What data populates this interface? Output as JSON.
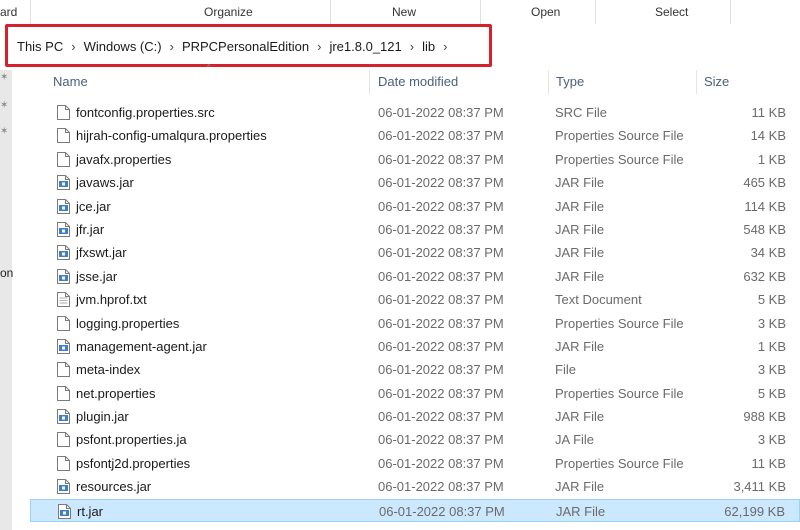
{
  "ribbon": {
    "left_label": "ard",
    "organize": "Organize",
    "new": "New",
    "open": "Open",
    "select": "Select"
  },
  "address_bar": {
    "crumbs": [
      "This PC",
      "Windows (C:)",
      "PRPCPersonalEdition",
      "jre1.8.0_121",
      "lib"
    ]
  },
  "side": {
    "text": "on"
  },
  "columns": {
    "name": "Name",
    "date": "Date modified",
    "type": "Type",
    "size": "Size"
  },
  "files": [
    {
      "name": "fontconfig.properties.src",
      "date": "06-01-2022 08:37 PM",
      "type": "SRC File",
      "size": "11 KB",
      "icon": "document-icon"
    },
    {
      "name": "hijrah-config-umalqura.properties",
      "date": "06-01-2022 08:37 PM",
      "type": "Properties Source File",
      "size": "14 KB",
      "icon": "document-icon"
    },
    {
      "name": "javafx.properties",
      "date": "06-01-2022 08:37 PM",
      "type": "Properties Source File",
      "size": "1 KB",
      "icon": "document-icon"
    },
    {
      "name": "javaws.jar",
      "date": "06-01-2022 08:37 PM",
      "type": "JAR File",
      "size": "465 KB",
      "icon": "jar-icon"
    },
    {
      "name": "jce.jar",
      "date": "06-01-2022 08:37 PM",
      "type": "JAR File",
      "size": "114 KB",
      "icon": "jar-icon"
    },
    {
      "name": "jfr.jar",
      "date": "06-01-2022 08:37 PM",
      "type": "JAR File",
      "size": "548 KB",
      "icon": "jar-icon"
    },
    {
      "name": "jfxswt.jar",
      "date": "06-01-2022 08:37 PM",
      "type": "JAR File",
      "size": "34 KB",
      "icon": "jar-icon"
    },
    {
      "name": "jsse.jar",
      "date": "06-01-2022 08:37 PM",
      "type": "JAR File",
      "size": "632 KB",
      "icon": "jar-icon"
    },
    {
      "name": "jvm.hprof.txt",
      "date": "06-01-2022 08:37 PM",
      "type": "Text Document",
      "size": "5 KB",
      "icon": "text-document-icon"
    },
    {
      "name": "logging.properties",
      "date": "06-01-2022 08:37 PM",
      "type": "Properties Source File",
      "size": "3 KB",
      "icon": "document-icon"
    },
    {
      "name": "management-agent.jar",
      "date": "06-01-2022 08:37 PM",
      "type": "JAR File",
      "size": "1 KB",
      "icon": "jar-icon"
    },
    {
      "name": "meta-index",
      "date": "06-01-2022 08:37 PM",
      "type": "File",
      "size": "3 KB",
      "icon": "document-icon"
    },
    {
      "name": "net.properties",
      "date": "06-01-2022 08:37 PM",
      "type": "Properties Source File",
      "size": "5 KB",
      "icon": "document-icon"
    },
    {
      "name": "plugin.jar",
      "date": "06-01-2022 08:37 PM",
      "type": "JAR File",
      "size": "988 KB",
      "icon": "jar-icon"
    },
    {
      "name": "psfont.properties.ja",
      "date": "06-01-2022 08:37 PM",
      "type": "JA File",
      "size": "3 KB",
      "icon": "document-icon"
    },
    {
      "name": "psfontj2d.properties",
      "date": "06-01-2022 08:37 PM",
      "type": "Properties Source File",
      "size": "11 KB",
      "icon": "document-icon"
    },
    {
      "name": "resources.jar",
      "date": "06-01-2022 08:37 PM",
      "type": "JAR File",
      "size": "3,411 KB",
      "icon": "jar-icon"
    },
    {
      "name": "rt.jar",
      "date": "06-01-2022 08:37 PM",
      "type": "JAR File",
      "size": "62,199 KB",
      "icon": "jar-icon",
      "selected": true
    }
  ],
  "colors": {
    "highlight_border": "#d6202e",
    "selection_bg": "#cce8ff",
    "header_text": "#4c607a"
  }
}
